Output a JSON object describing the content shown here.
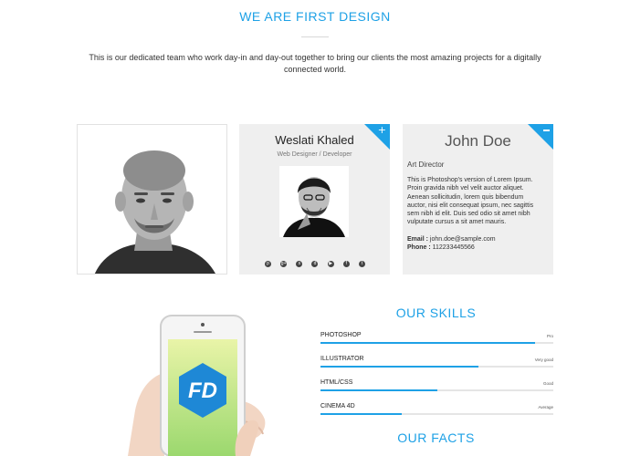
{
  "header": {
    "title": "WE ARE FIRST DESIGN",
    "intro": "This is our dedicated team who work day-in and day-out together to bring our clients the most amazing projects for a digitally connected world."
  },
  "team": {
    "weslati": {
      "name": "Weslati Khaled",
      "role": "Web Designer / Developer",
      "plus_icon": "+"
    },
    "john": {
      "name": "John Doe",
      "role": "Art Director",
      "bio": "This is Photoshop's version of Lorem Ipsum. Proin gravida nibh vel velit auctor aliquet. Aenean sollicitudin, lorem quis bibendum auctor, nisi elit consequat ipsum, nec sagittis sem nibh id elit. Duis sed odio sit amet nibh vulputate cursus a sit amet mauris.",
      "email_label": "Email :",
      "email": "john.doe@sample.com",
      "phone_label": "Phone :",
      "phone": "112233445566"
    }
  },
  "social_icons": [
    "pinterest-icon",
    "google-plus-icon",
    "skype-icon",
    "dribbble-icon",
    "youtube-icon",
    "facebook-icon",
    "twitter-icon"
  ],
  "social_glyphs": [
    "p",
    "g+",
    "s",
    "d",
    "▶",
    "f",
    "t"
  ],
  "skills_section": {
    "title": "OUR SKILLS",
    "items": [
      {
        "name": "PHOTOSHOP",
        "level": "Pro",
        "percent": 92
      },
      {
        "name": "ILLUSTRATOR",
        "level": "Very good",
        "percent": 68
      },
      {
        "name": "HTML/CSS",
        "level": "Good",
        "percent": 50
      },
      {
        "name": "CINEMA 4D",
        "level": "Average",
        "percent": 35
      }
    ]
  },
  "facts_section": {
    "title": "OUR FACTS"
  },
  "phone_mockup": {
    "logo_text": "FD"
  },
  "colors": {
    "accent": "#1ea1e6",
    "card_bg": "#efefef",
    "track": "#e5e5e5"
  }
}
